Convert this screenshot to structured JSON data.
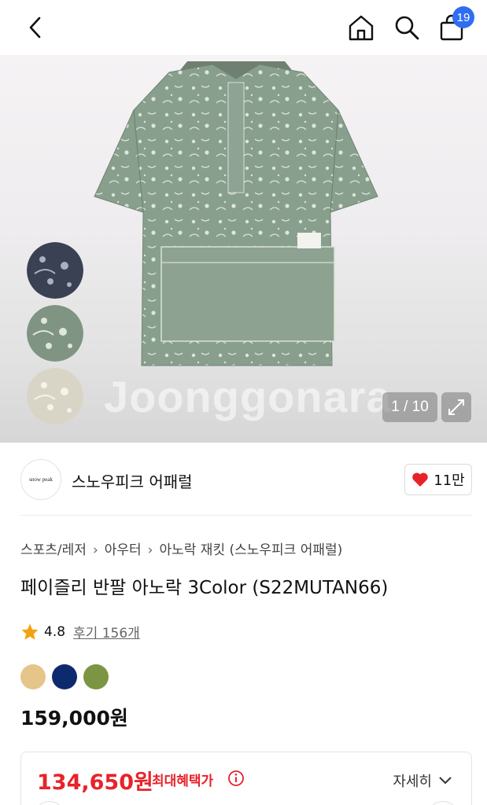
{
  "header": {
    "back_icon": "chevron-left-icon",
    "home_icon": "home-icon",
    "search_icon": "search-icon",
    "bag_icon": "shopping-bag-icon",
    "cart_count": "19",
    "badge_color": "#2f6ef2"
  },
  "gallery": {
    "watermark": "Joonggonara",
    "counter": "1 / 10",
    "expand_icon": "expand-icon",
    "thumbnails": [
      {
        "label": "navy",
        "color": "#3a4152"
      },
      {
        "label": "khaki",
        "color": "#7f9482"
      },
      {
        "label": "beige",
        "color": "#d9d5c6"
      }
    ]
  },
  "brand": {
    "logo_text": "snow peak",
    "name": "스노우피크 어패럴",
    "likes": "11만",
    "heart_color": "#e8222a"
  },
  "product": {
    "breadcrumb": [
      "스포츠/레저",
      "아우터",
      "아노락 재킷 (스노우피크 어패럴)"
    ],
    "title": "페이즐리 반팔 아노락 3Color (S22MUTAN66)",
    "rating": "4.8",
    "reviews": "후기 156개",
    "swatches": [
      "#e6c58a",
      "#0e2a6e",
      "#7b9542"
    ],
    "price": "159,000원"
  },
  "benefit": {
    "sale_price": "134,650원",
    "label": "최대혜택가",
    "detail": "자세히",
    "accent": "#e8222a"
  }
}
